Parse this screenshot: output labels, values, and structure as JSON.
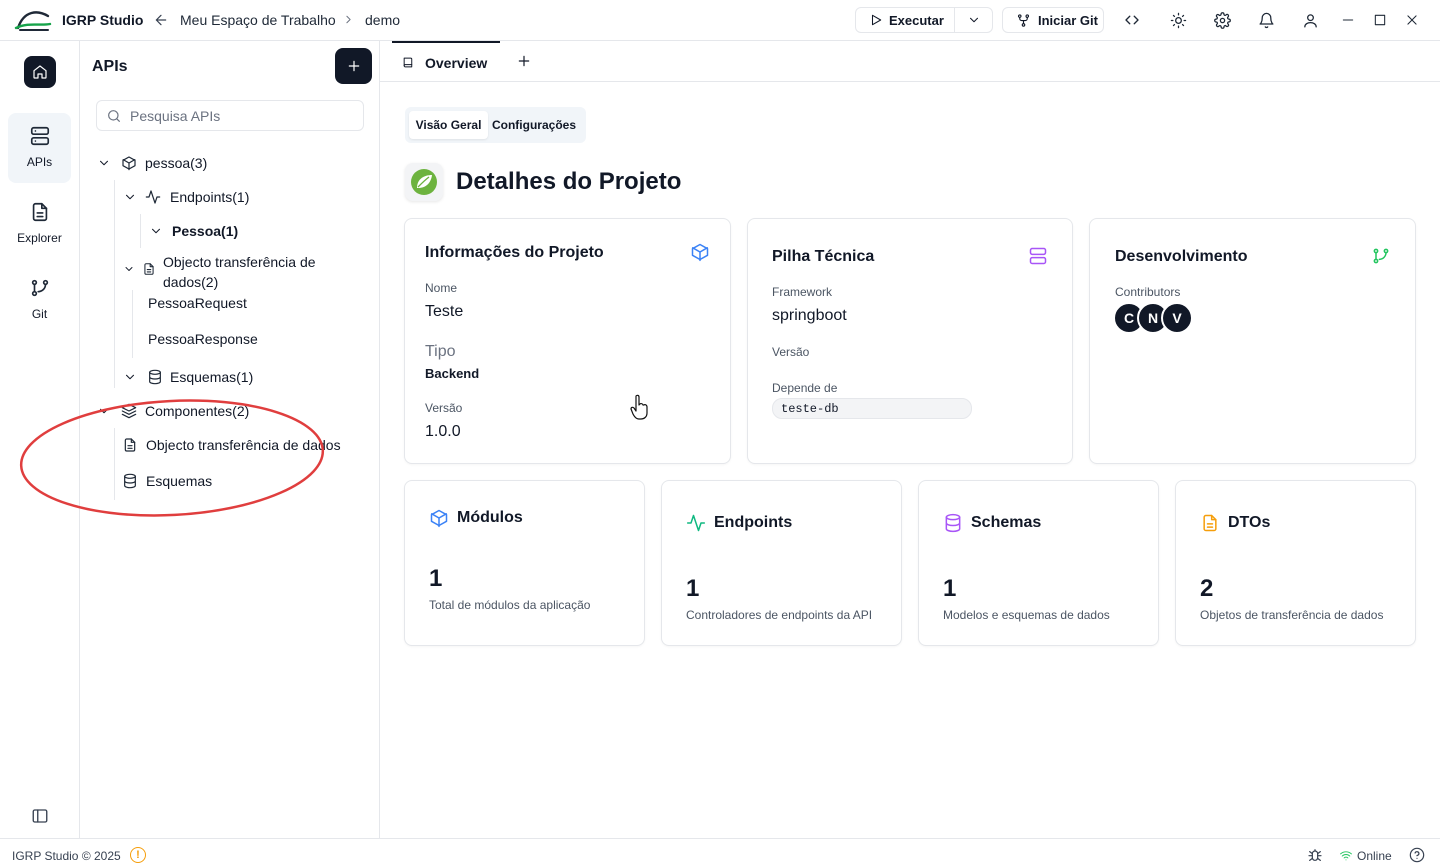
{
  "titlebar": {
    "app_name": "IGRP Studio",
    "breadcrumb_workspace": "Meu Espaço de Trabalho",
    "breadcrumb_project": "demo",
    "run_label": "Executar",
    "git_label": "Iniciar Git"
  },
  "rail": {
    "items": [
      {
        "label": "APIs",
        "icon": "server-icon",
        "active": true
      },
      {
        "label": "Explorer",
        "icon": "file-icon",
        "active": false
      },
      {
        "label": "Git",
        "icon": "git-branch-icon",
        "active": false
      }
    ]
  },
  "panel": {
    "title": "APIs",
    "search_placeholder": "Pesquisa APIs",
    "tree": {
      "pessoa": "pessoa(3)",
      "endpoints": "Endpoints(1)",
      "endpoint_pessoa": "Pessoa(1)",
      "dtos_line1": "Objecto transferência de",
      "dtos_line2": "dados(2)",
      "dto_request": "PessoaRequest",
      "dto_response": "PessoaResponse",
      "schemas": "Esquemas(1)",
      "componentes": "Componentes(2)",
      "comp_dtos": "Objecto transferência de dados",
      "comp_schemas": "Esquemas"
    }
  },
  "tabs": {
    "overview": "Overview"
  },
  "segmented": {
    "overview": "Visão Geral",
    "settings": "Configurações"
  },
  "page": {
    "title": "Detalhes do Projeto"
  },
  "project_info": {
    "title": "Informações do Projeto",
    "name_label": "Nome",
    "name_value": "Teste",
    "type_label": "Tipo",
    "type_value": "Backend",
    "version_label": "Versão",
    "version_value": "1.0.0"
  },
  "tech_stack": {
    "title": "Pilha Técnica",
    "framework_label": "Framework",
    "framework_value": "springboot",
    "version_label": "Versão",
    "depends_label": "Depende de",
    "depends_value": "teste-db"
  },
  "development": {
    "title": "Desenvolvimento",
    "contributors_label": "Contributors",
    "contributors": [
      "C",
      "N",
      "V"
    ]
  },
  "stats": [
    {
      "title": "Módulos",
      "value": "1",
      "desc": "Total de módulos da aplicação",
      "color": "#3b82f6"
    },
    {
      "title": "Endpoints",
      "value": "1",
      "desc": "Controladores de endpoints da API",
      "color": "#10b981"
    },
    {
      "title": "Schemas",
      "value": "1",
      "desc": "Modelos e esquemas de dados",
      "color": "#a855f7"
    },
    {
      "title": "DTOs",
      "value": "2",
      "desc": "Objetos de transferência de dados",
      "color": "#f59e0b"
    }
  ],
  "statusbar": {
    "copyright": "IGRP Studio © 2025",
    "status": "Online"
  },
  "colors": {
    "accent_dark": "#111827",
    "online_green": "#22c55e",
    "warning_orange": "#f59e0b",
    "annotation_red": "#e03e3e"
  }
}
